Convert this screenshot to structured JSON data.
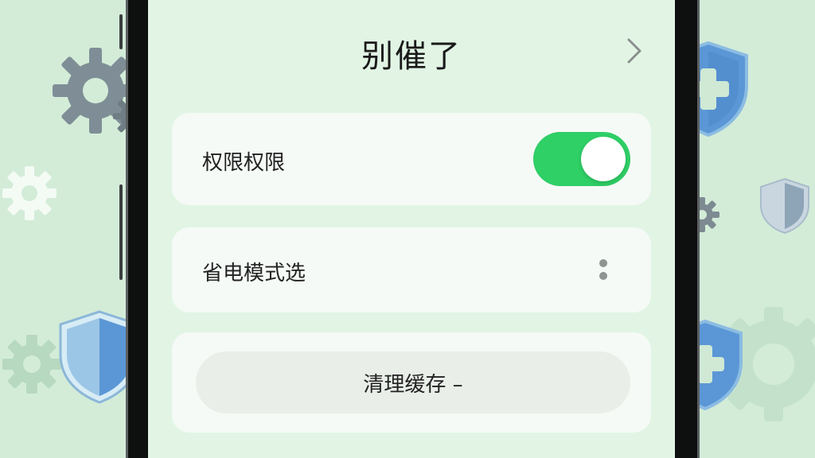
{
  "header": {
    "title": "别催了"
  },
  "settings": {
    "permission_label": "权限权限",
    "permission_toggle_on": true,
    "power_mode_label": "省电模式选",
    "clear_cache_label": "清理缓存 –"
  },
  "icons": {
    "back": "chevron-right-icon",
    "more": "more-vertical-icon",
    "decorations": [
      "gear-icon",
      "shield-plus-icon",
      "shield-icon"
    ]
  },
  "colors": {
    "background": "#d6eedb",
    "screen": "#e2f5e5",
    "card": "#f5faf6",
    "toggle_on": "#2fd167",
    "shield_blue": "#5b97d6",
    "gear_gray": "#7f8e96"
  }
}
